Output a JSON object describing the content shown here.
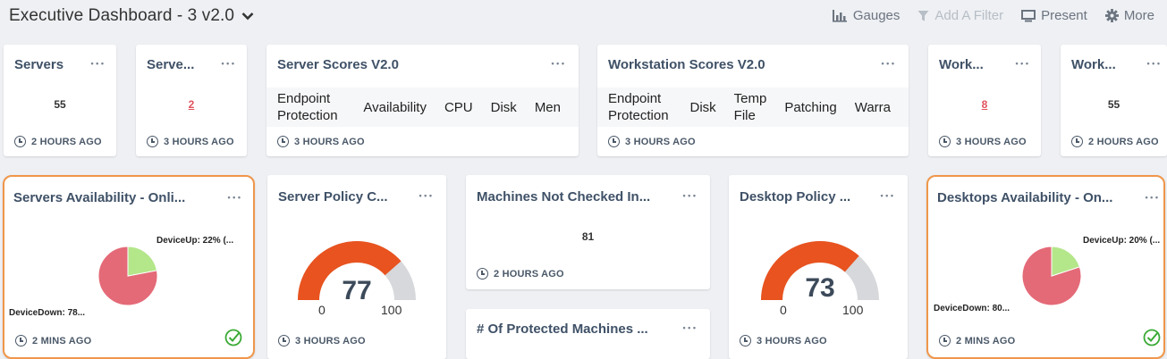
{
  "header": {
    "title": "Executive Dashboard - 3 v2.0",
    "actions": {
      "gauges": "Gauges",
      "add_filter": "Add A Filter",
      "present": "Present",
      "more": "More"
    }
  },
  "colors": {
    "gauge_fill": "#e8531f",
    "gauge_track": "#d6d8db",
    "pie_down": "#e46a78",
    "pie_up": "#b4e68a",
    "highlight": "#f0964a",
    "ok_green": "#3aaa35"
  },
  "cards": {
    "servers": {
      "title": "Servers",
      "value": "55",
      "time": "2 HOURS AGO"
    },
    "servers2": {
      "title": "Serve...",
      "value": "2",
      "time": "3 HOURS AGO"
    },
    "server_scores": {
      "title": "Server Scores V2.0",
      "columns": [
        "Endpoint Protection",
        "Availability",
        "CPU",
        "Disk",
        "Men"
      ],
      "time": "3 HOURS AGO"
    },
    "workstation_scores": {
      "title": "Workstation Scores V2.0",
      "columns": [
        "Endpoint Protection",
        "Disk",
        "Temp File",
        "Patching",
        "Warra"
      ],
      "time": "3 HOURS AGO"
    },
    "work1": {
      "title": "Work...",
      "value": "8",
      "time": "3 HOURS AGO"
    },
    "work2": {
      "title": "Work...",
      "value": "55",
      "time": "2 HOURS AGO"
    },
    "servers_availability": {
      "title": "Servers Availability - Onli...",
      "up_label": "DeviceUp: 22% (...",
      "down_label": "DeviceDown: 78...",
      "up_pct": 22,
      "time": "2 MINS AGO"
    },
    "server_policy": {
      "title": "Server Policy C...",
      "value": "77",
      "min": "0",
      "max": "100",
      "time": "3 HOURS AGO"
    },
    "machines_not_checked": {
      "title": "Machines Not Checked In...",
      "value": "81",
      "time": "2 HOURS AGO"
    },
    "protected_machines": {
      "title": "# Of Protected Machines ..."
    },
    "desktop_policy": {
      "title": "Desktop Policy ...",
      "value": "73",
      "min": "0",
      "max": "100",
      "time": "3 HOURS AGO"
    },
    "desktops_availability": {
      "title": "Desktops Availability - On...",
      "up_label": "DeviceUp: 20% (...",
      "down_label": "DeviceDown: 80...",
      "up_pct": 20,
      "time": "2 MINS AGO"
    }
  },
  "menu_icon": "more-dots-icon",
  "more_dots": "• • •"
}
